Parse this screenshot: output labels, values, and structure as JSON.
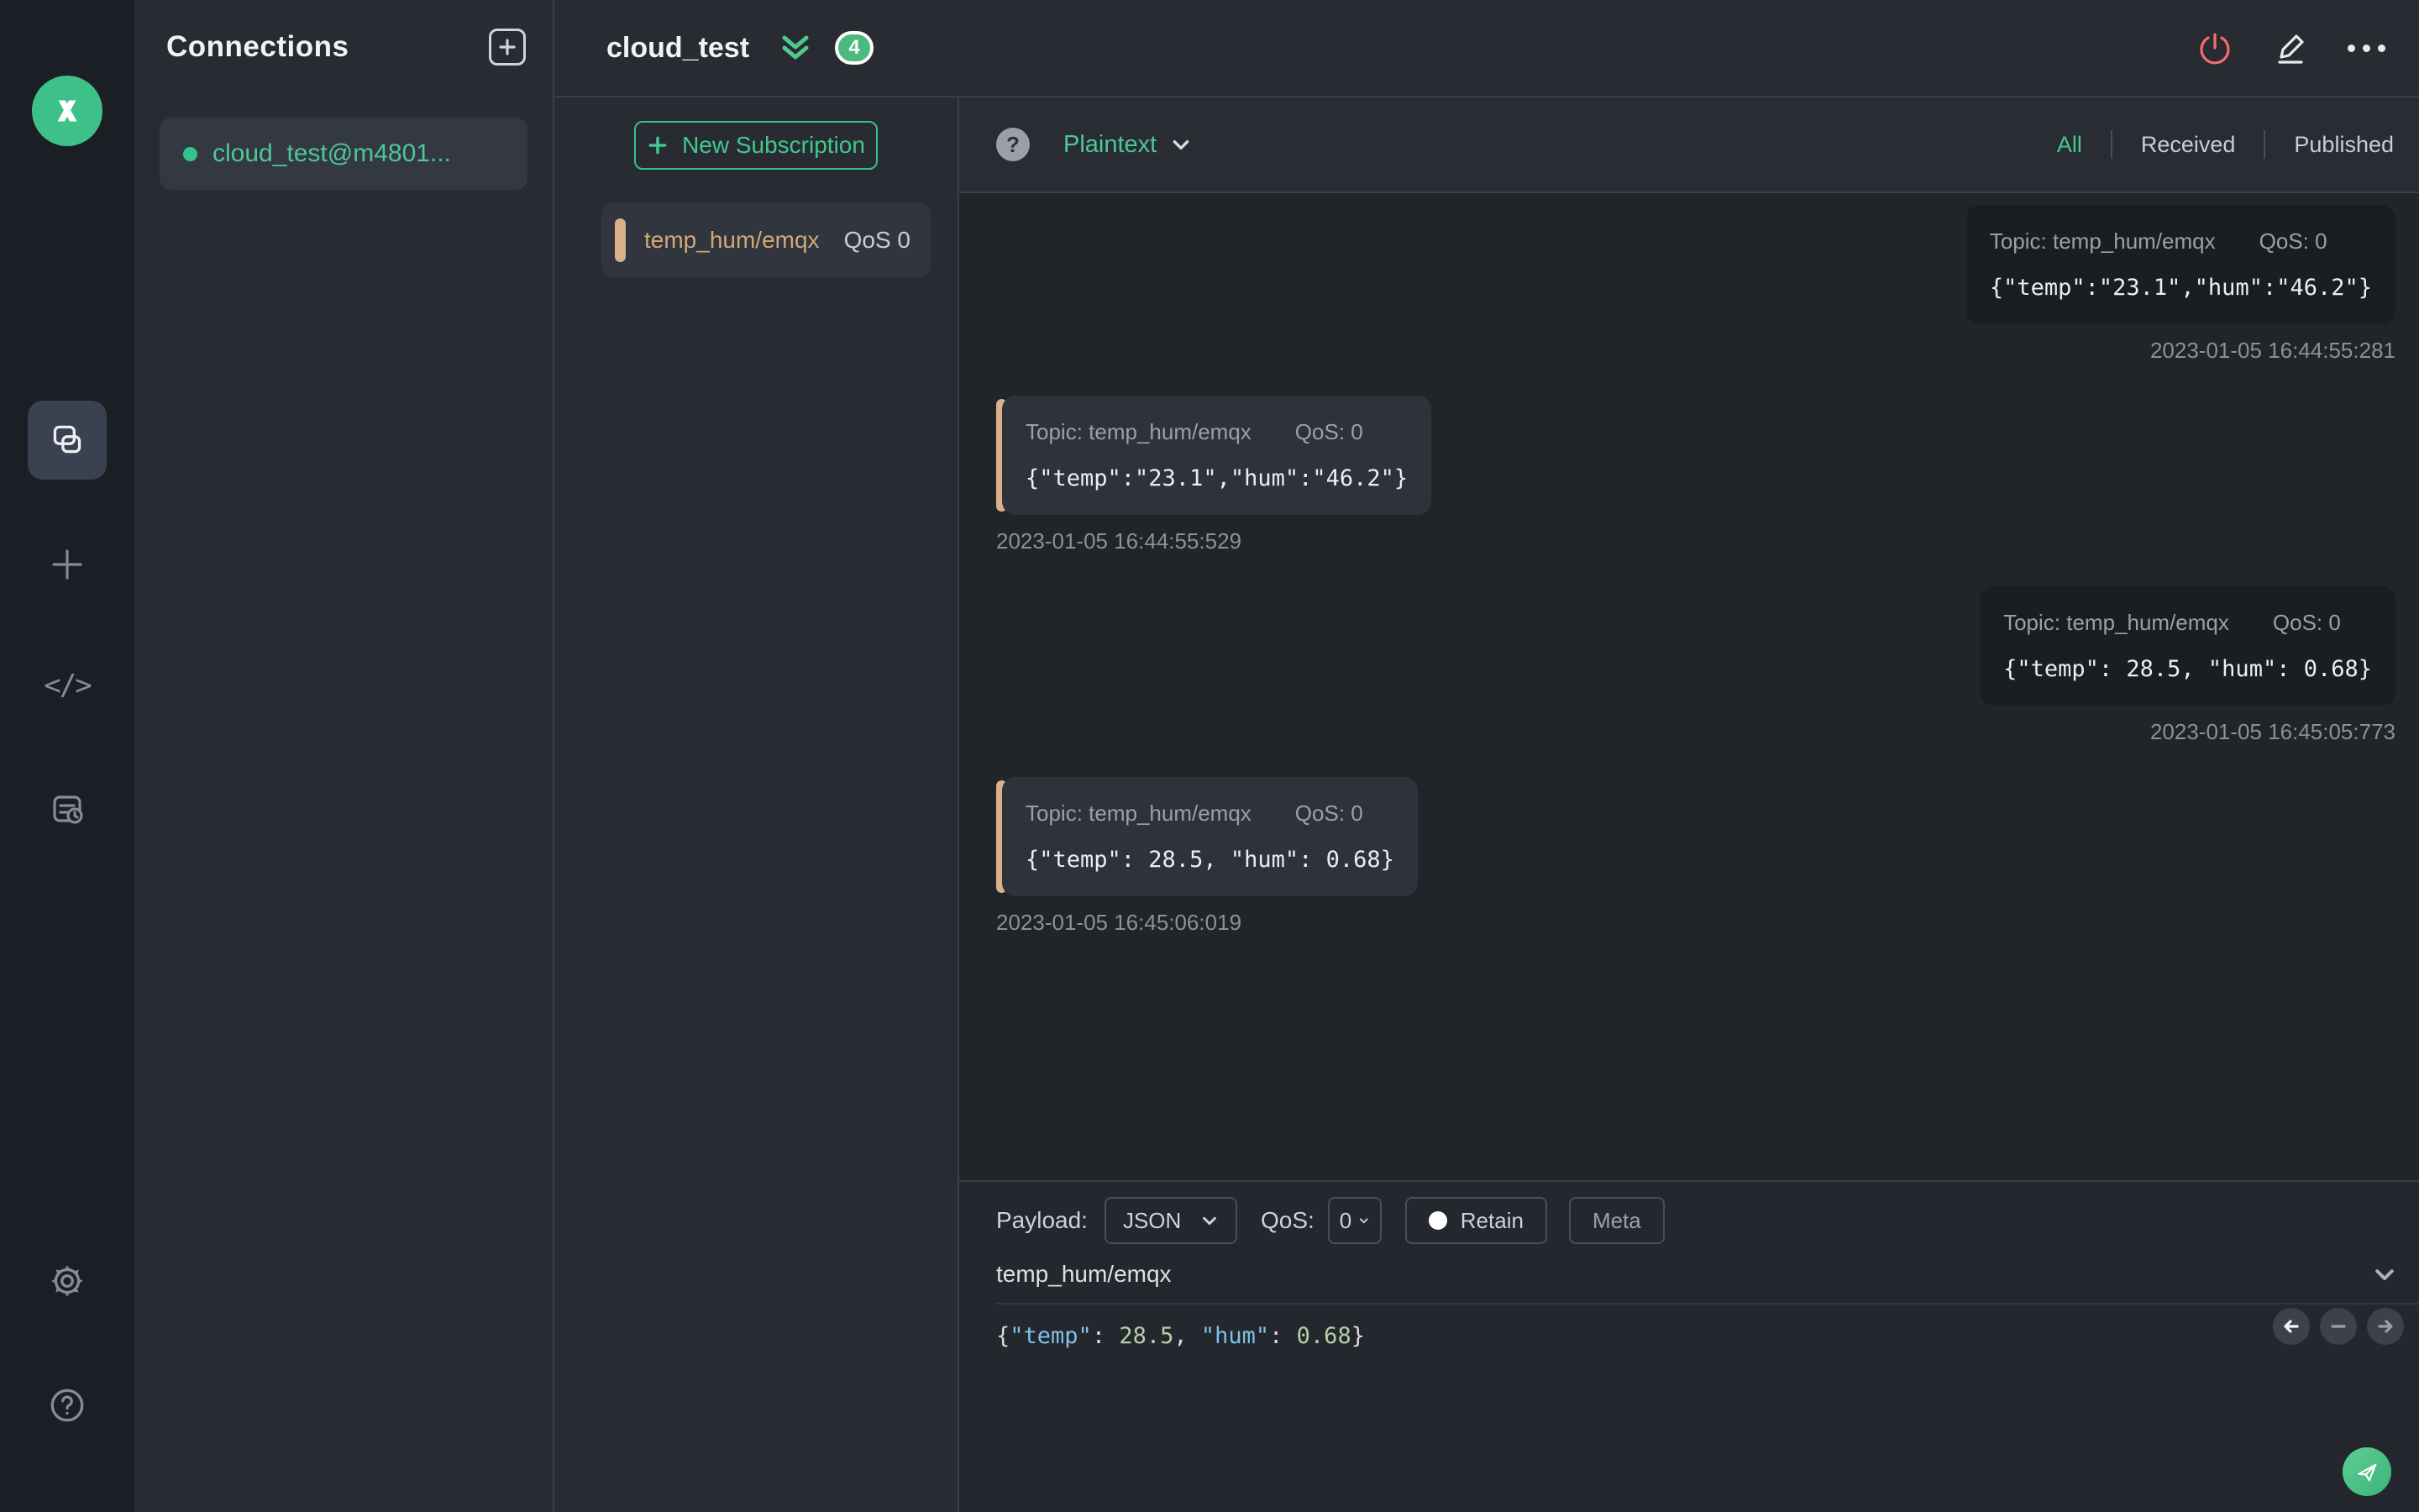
{
  "colors": {
    "accent": "#34c388",
    "danger": "#f56c6c",
    "topic_accent": "#d9b188",
    "badge_bg": "#4cb97e"
  },
  "sidebar": {
    "logo_icon": "mqttx-logo",
    "nav_icons": [
      "connections-icon",
      "new-connection-plus-icon",
      "script-code-icon",
      "log-icon"
    ],
    "bottom_icons": [
      "settings-gear-icon",
      "help-question-icon"
    ],
    "code_glyph": "</>"
  },
  "connections": {
    "title": "Connections",
    "add_button_icon": "plus-square-icon",
    "items": [
      {
        "name": "cloud_test@m4801...",
        "connected": true,
        "selected": true
      }
    ]
  },
  "connection_header": {
    "title": "cloud_test",
    "unread_count": "4",
    "actions": [
      "disconnect-power-icon",
      "edit-pencil-icon",
      "more-ellipsis-icon"
    ]
  },
  "subscriptions": {
    "new_button_label": "New Subscription",
    "items": [
      {
        "topic": "temp_hum/emqx",
        "qos": "QoS 0"
      }
    ]
  },
  "message_toolbar": {
    "help_glyph": "?",
    "format": "Plaintext",
    "filters": [
      {
        "label": "All",
        "active": true
      },
      {
        "label": "Received",
        "active": false
      },
      {
        "label": "Published",
        "active": false
      }
    ]
  },
  "messages": [
    {
      "direction": "publish",
      "topic": "Topic: temp_hum/emqx",
      "qos": "QoS: 0",
      "payload": "{\"temp\":\"23.1\",\"hum\":\"46.2\"}",
      "timestamp": "2023-01-05 16:44:55:281"
    },
    {
      "direction": "receive",
      "topic": "Topic: temp_hum/emqx",
      "qos": "QoS: 0",
      "payload": "{\"temp\":\"23.1\",\"hum\":\"46.2\"}",
      "timestamp": "2023-01-05 16:44:55:529"
    },
    {
      "direction": "publish",
      "topic": "Topic: temp_hum/emqx",
      "qos": "QoS: 0",
      "payload": "{\"temp\": 28.5, \"hum\": 0.68}",
      "timestamp": "2023-01-05 16:45:05:773"
    },
    {
      "direction": "receive",
      "topic": "Topic: temp_hum/emqx",
      "qos": "QoS: 0",
      "payload": "{\"temp\": 28.5, \"hum\": 0.68}",
      "timestamp": "2023-01-05 16:45:06:019"
    }
  ],
  "publish": {
    "payload_label": "Payload:",
    "payload_format": "JSON",
    "qos_label": "QoS:",
    "qos_value": "0",
    "retain_label": "Retain",
    "meta_label": "Meta",
    "topic_value": "temp_hum/emqx",
    "editor_parts": [
      {
        "t": "{"
      },
      {
        "t": "\"temp\""
      },
      {
        "t": ": "
      },
      {
        "t": "28.5"
      },
      {
        "t": ", "
      },
      {
        "t": "\"hum\""
      },
      {
        "t": ": "
      },
      {
        "t": "0.68"
      },
      {
        "t": "}"
      }
    ]
  }
}
